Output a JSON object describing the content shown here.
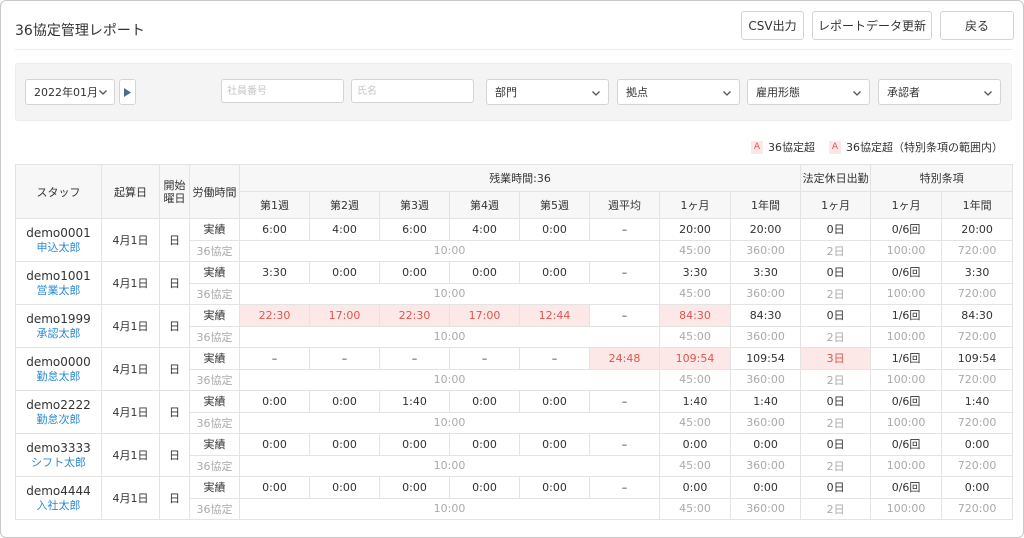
{
  "header": {
    "title": "36協定管理レポート",
    "csv_label": "CSV出力",
    "refresh_label": "レポートデータ更新",
    "back_label": "戻る"
  },
  "filters": {
    "month": "2022年01月",
    "employee_no_placeholder": "社員番号",
    "name_placeholder": "氏名",
    "department": "部門",
    "location": "拠点",
    "employment_type": "雇用形態",
    "approver": "承認者"
  },
  "legend": {
    "mark": "A",
    "over_36": "36協定超",
    "over_36_special": "36協定超（特別条項の範囲内）"
  },
  "table": {
    "headers": {
      "staff": "スタッフ",
      "start_day": "起算日",
      "start_weekday_1": "開始",
      "start_weekday_2": "曜日",
      "work_time": "労働時間",
      "overtime_group": "残業時間:36",
      "week1": "第1週",
      "week2": "第2週",
      "week3": "第3週",
      "week4": "第4週",
      "week5": "第5週",
      "week_avg": "週平均",
      "month": "1ヶ月",
      "year": "1年間",
      "holiday_group": "法定休日出勤",
      "holiday_month": "1ヶ月",
      "special_group": "特別条項",
      "special_month": "1ヶ月",
      "special_year": "1年間"
    },
    "label_actual": "実績",
    "label_36": "36協定",
    "limits": {
      "weekly": "10:00",
      "month": "45:00",
      "year": "360:00",
      "holiday": "2日",
      "special_month": "100:00",
      "special_year": "720:00"
    },
    "rows": [
      {
        "id": "demo0001",
        "name": "申込太郎",
        "start_day": "4月1日",
        "weekday": "日",
        "w1": "6:00",
        "w2": "4:00",
        "w3": "6:00",
        "w4": "4:00",
        "w5": "0:00",
        "avg": "–",
        "month": "20:00",
        "year": "20:00",
        "holiday": "0日",
        "sp_count": "0/6回",
        "sp_year": "20:00"
      },
      {
        "id": "demo1001",
        "name": "営業太郎",
        "start_day": "4月1日",
        "weekday": "日",
        "w1": "3:30",
        "w2": "0:00",
        "w3": "0:00",
        "w4": "0:00",
        "w5": "0:00",
        "avg": "–",
        "month": "3:30",
        "year": "3:30",
        "holiday": "0日",
        "sp_count": "0/6回",
        "sp_year": "3:30"
      },
      {
        "id": "demo1999",
        "name": "承認太郎",
        "start_day": "4月1日",
        "weekday": "日",
        "w1": "22:30",
        "w2": "17:00",
        "w3": "22:30",
        "w4": "17:00",
        "w5": "12:44",
        "avg": "–",
        "month": "84:30",
        "year": "84:30",
        "holiday": "0日",
        "sp_count": "1/6回",
        "sp_year": "84:30"
      },
      {
        "id": "demo0000",
        "name": "勤怠太郎",
        "start_day": "4月1日",
        "weekday": "日",
        "w1": "–",
        "w2": "–",
        "w3": "–",
        "w4": "–",
        "w5": "–",
        "avg": "24:48",
        "month": "109:54",
        "year": "109:54",
        "holiday": "3日",
        "sp_count": "1/6回",
        "sp_year": "109:54"
      },
      {
        "id": "demo2222",
        "name": "勤怠次郎",
        "start_day": "4月1日",
        "weekday": "日",
        "w1": "0:00",
        "w2": "0:00",
        "w3": "1:40",
        "w4": "0:00",
        "w5": "0:00",
        "avg": "–",
        "month": "1:40",
        "year": "1:40",
        "holiday": "0日",
        "sp_count": "0/6回",
        "sp_year": "1:40"
      },
      {
        "id": "demo3333",
        "name": "シフト太郎",
        "start_day": "4月1日",
        "weekday": "日",
        "w1": "0:00",
        "w2": "0:00",
        "w3": "0:00",
        "w4": "0:00",
        "w5": "0:00",
        "avg": "–",
        "month": "0:00",
        "year": "0:00",
        "holiday": "0日",
        "sp_count": "0/6回",
        "sp_year": "0:00"
      },
      {
        "id": "demo4444",
        "name": "入社太郎",
        "start_day": "4月1日",
        "weekday": "日",
        "w1": "0:00",
        "w2": "0:00",
        "w3": "0:00",
        "w4": "0:00",
        "w5": "0:00",
        "avg": "–",
        "month": "0:00",
        "year": "0:00",
        "holiday": "0日",
        "sp_count": "0/6回",
        "sp_year": "0:00"
      }
    ]
  },
  "colors": {
    "accent_link": "#2a8ad4",
    "over_background": "#fde8e8",
    "over_text": "#e0554f"
  }
}
